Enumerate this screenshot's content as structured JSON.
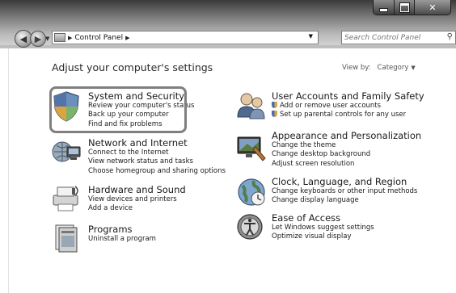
{
  "address": {
    "path": "Control Panel"
  },
  "search": {
    "placeholder": "Search Control Panel"
  },
  "heading": "Adjust your computer's settings",
  "view_by": {
    "label": "View by:",
    "value": "Category"
  },
  "left_categories": [
    {
      "title": "System and Security",
      "links": [
        "Review your computer's status",
        "Back up your computer",
        "Find and fix problems"
      ]
    },
    {
      "title": "Network and Internet",
      "links": [
        "Connect to the Internet",
        "View network status and tasks",
        "Choose homegroup and sharing options"
      ]
    },
    {
      "title": "Hardware and Sound",
      "links": [
        "View devices and printers",
        "Add a device"
      ]
    },
    {
      "title": "Programs",
      "links": [
        "Uninstall a program"
      ]
    }
  ],
  "right_categories": [
    {
      "title": "User Accounts and Family Safety",
      "links": [
        "Add or remove user accounts",
        "Set up parental controls for any user"
      ]
    },
    {
      "title": "Appearance and Personalization",
      "links": [
        "Change the theme",
        "Change desktop background",
        "Adjust screen resolution"
      ]
    },
    {
      "title": "Clock, Language, and Region",
      "links": [
        "Change keyboards or other input methods",
        "Change display language"
      ]
    },
    {
      "title": "Ease of Access",
      "links": [
        "Let Windows suggest settings",
        "Optimize visual display"
      ]
    }
  ]
}
